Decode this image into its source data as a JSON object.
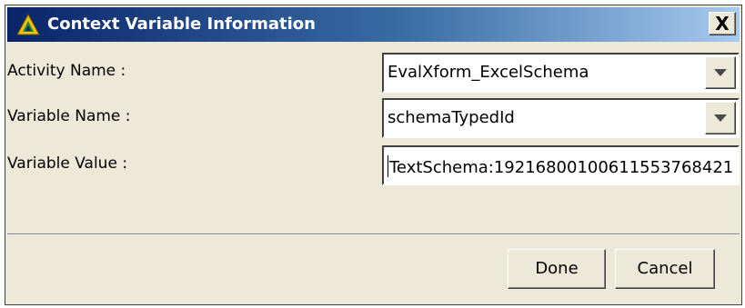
{
  "dialog": {
    "title": "Context Variable Information",
    "close_label": "X"
  },
  "form": {
    "activity": {
      "label": "Activity Name :",
      "value": "EvalXform_ExcelSchema"
    },
    "variable_name": {
      "label": "Variable Name :",
      "value": "schemaTypedId"
    },
    "variable_value": {
      "label": "Variable Value :",
      "value": "TextSchema:19216800100611553768421"
    }
  },
  "buttons": {
    "done": "Done",
    "cancel": "Cancel"
  },
  "icons": {
    "app": "app-logo-icon",
    "close": "close-icon",
    "dropdown": "chevron-down-icon"
  },
  "colors": {
    "titlebar_start": "#0a246a",
    "titlebar_end": "#a6caf0",
    "dialog_bg": "#ece9d8"
  }
}
